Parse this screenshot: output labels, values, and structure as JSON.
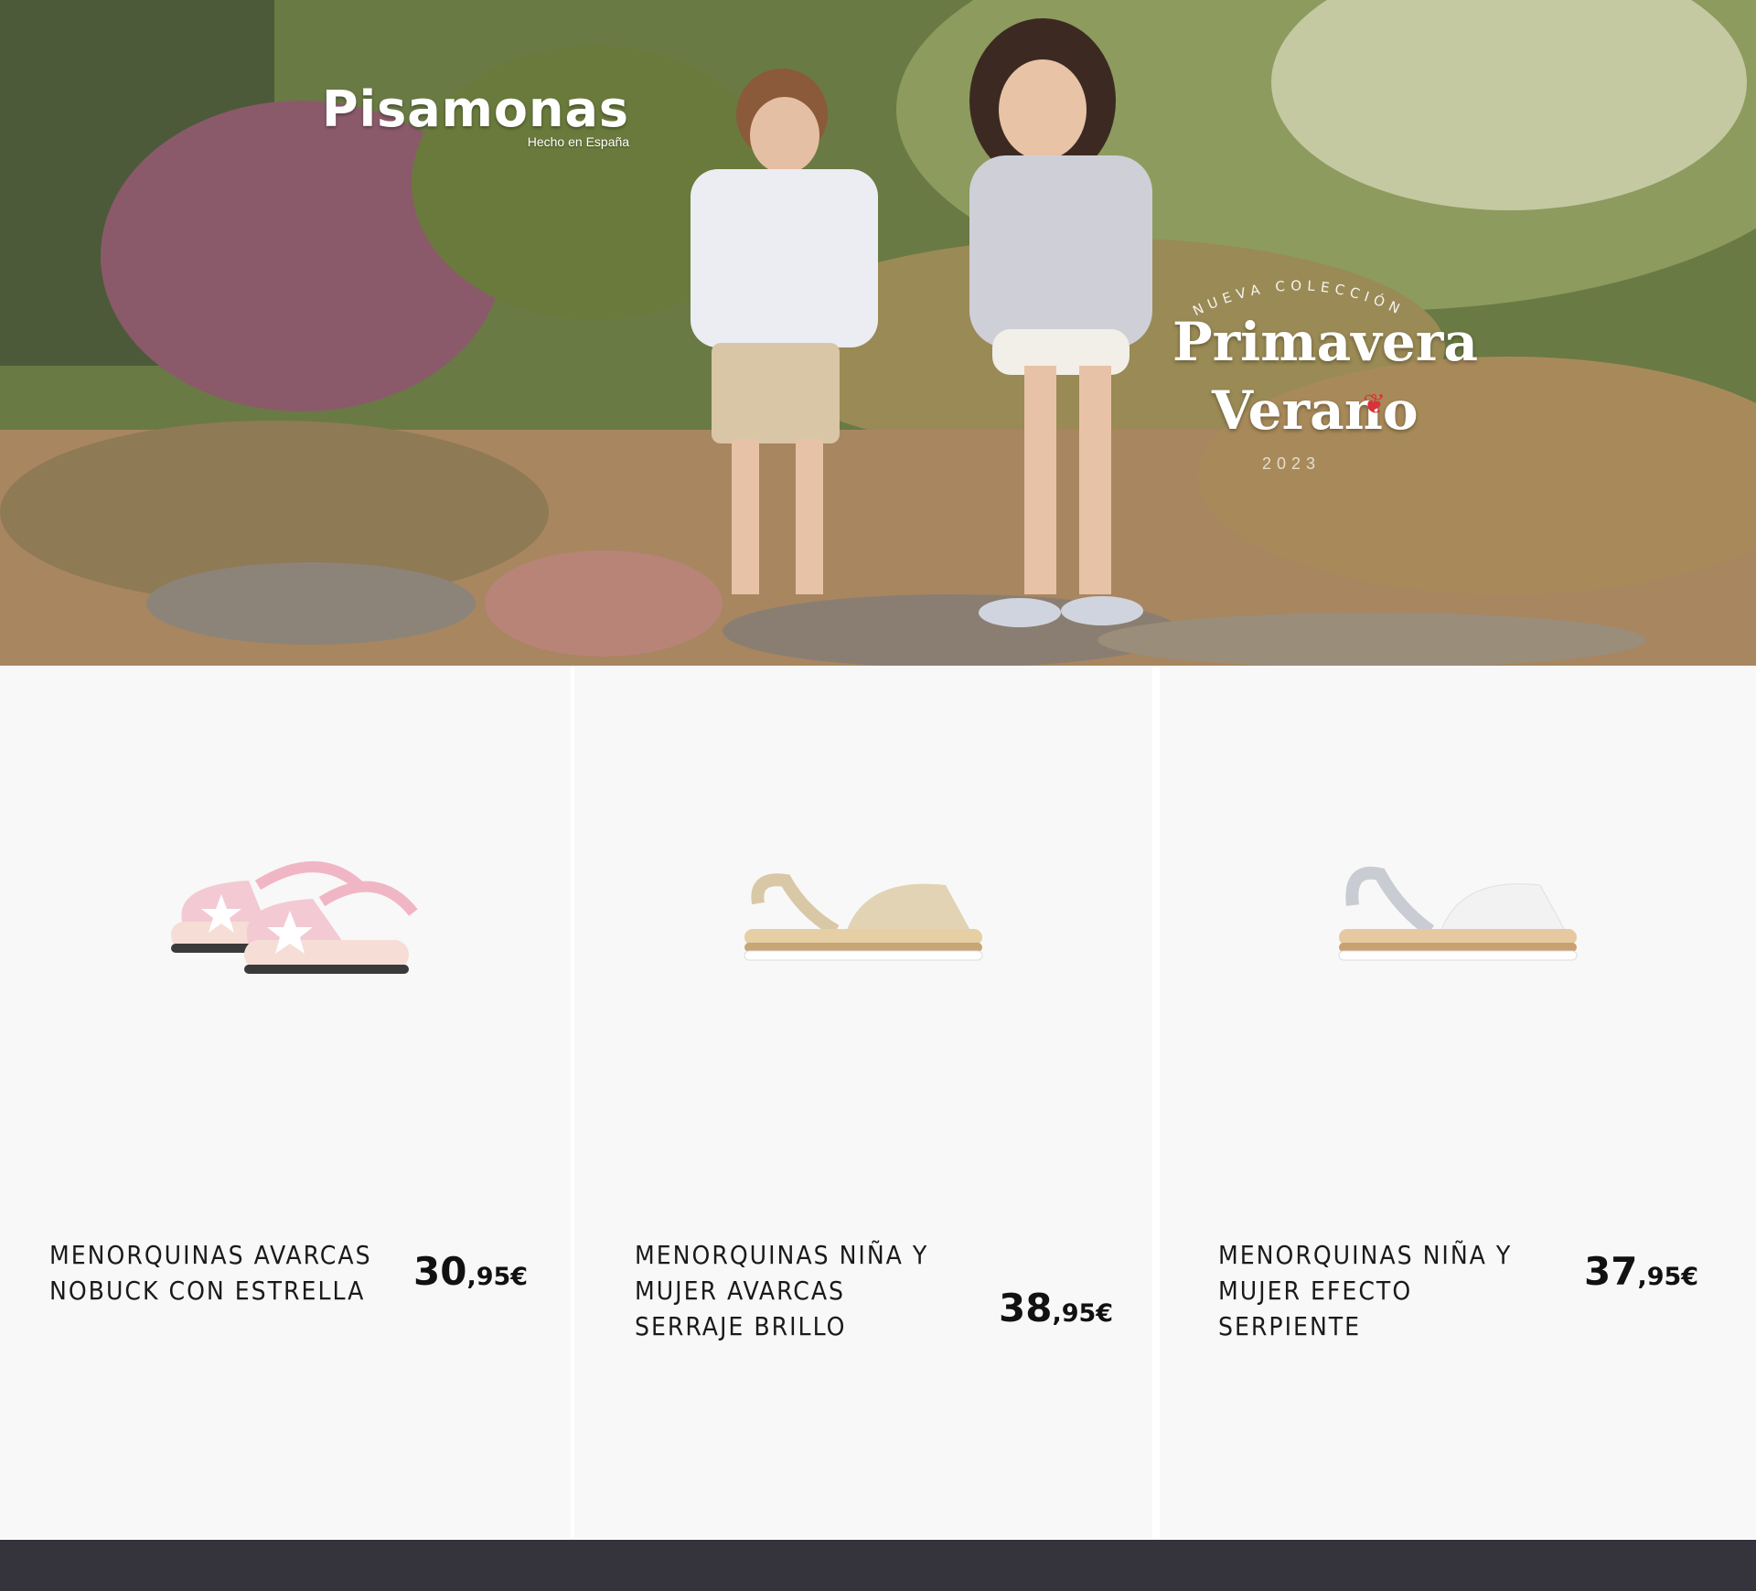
{
  "hero": {
    "brand": {
      "name": "Pisamonas",
      "tagline": "Hecho en España"
    },
    "promo": {
      "eyebrow": "NUEVA COLECCIÓN",
      "line1": "Primavera",
      "line2": "Verano",
      "year": "2023",
      "accent_color": "#d8323a"
    }
  },
  "products": [
    {
      "name": "MENORQUINAS AVARCAS NOBUCK CON ESTRELLA",
      "price_int": "30",
      "price_dec": ",95€",
      "color": "#f3c9d4",
      "image_icon": "pink-star-sandals-icon"
    },
    {
      "name": "MENORQUINAS NIÑA Y MUJER AVARCAS SERRAJE BRILLO",
      "price_int": "38",
      "price_dec": ",95€",
      "color": "#e2d3b5",
      "image_icon": "beige-sandal-icon"
    },
    {
      "name": "MENORQUINAS NIÑA Y MUJER EFECTO SERPIENTE",
      "price_int": "37",
      "price_dec": ",95€",
      "color": "#f2f2f2",
      "image_icon": "white-snake-sandal-icon"
    }
  ],
  "colors": {
    "footer": "#35333c",
    "card_bg": "#f8f8f8"
  }
}
